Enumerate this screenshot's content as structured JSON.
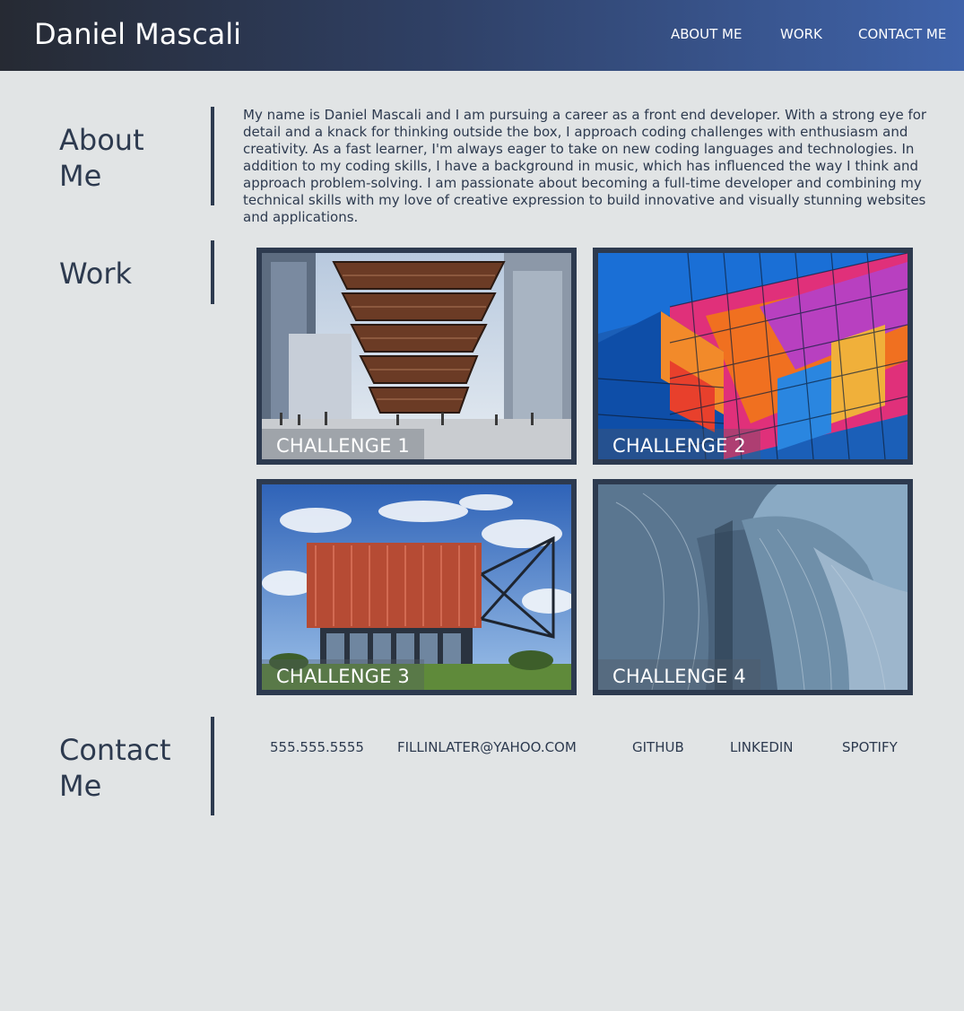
{
  "header": {
    "title": "Daniel Mascali",
    "nav": [
      "ABOUT ME",
      "WORK",
      "CONTACT ME"
    ]
  },
  "about": {
    "heading": "About\nMe",
    "text": "My name is Daniel Mascali and I am pursuing a career as a front end developer. With a strong eye for detail and a knack for thinking outside the box, I approach coding challenges with enthusiasm and creativity. As a fast learner, I'm always eager to take on new coding languages and technologies. In addition to my coding skills, I have a background in music, which has influenced the way I think and approach problem-solving. I am passionate about becoming a full-time developer and combining my technical skills with my love of creative expression to build innovative and visually stunning websites and applications."
  },
  "work": {
    "heading": "Work",
    "cards": [
      {
        "label": "CHALLENGE 1"
      },
      {
        "label": "CHALLENGE 2"
      },
      {
        "label": "CHALLENGE 3"
      },
      {
        "label": "CHALLENGE 4"
      }
    ]
  },
  "contact": {
    "heading": "Contact\nMe",
    "links": [
      "555.555.5555",
      "FILLINLATER@YAHOO.COM",
      "GITHUB",
      "LINKEDIN",
      "SPOTIFY"
    ]
  },
  "colors": {
    "background": "#e1e4e5",
    "text": "#2d3a4f",
    "header_start": "#262a33",
    "header_end": "#3f63aa"
  }
}
